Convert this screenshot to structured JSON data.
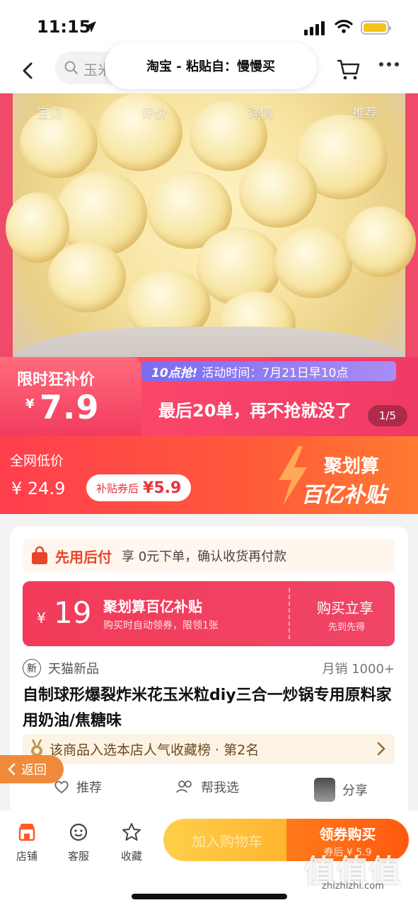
{
  "status": {
    "time": "11:15"
  },
  "nav": {
    "search_text": "玉米",
    "paste_banner": "淘宝 - 粘贴自：慢慢买"
  },
  "hero": {
    "tabs": [
      "宝贝",
      "评价",
      "详情",
      "推荐"
    ],
    "page_indicator": "1/5"
  },
  "promo": {
    "label": "限时狂补价",
    "yen": "¥",
    "price": "7.9",
    "flash_tag": "10点抢!",
    "activity_time": "活动时间：7月21日早10点",
    "main_text": "最后20单，再不抢就没了"
  },
  "price_banner": {
    "label": "全网低价",
    "original_price": "¥ 24.9",
    "coupon_label": "补贴券后",
    "coupon_price": "¥5.9",
    "logo_line1": "聚划算",
    "logo_line2": "百亿补贴"
  },
  "card": {
    "paylater_title": "先用后付",
    "paylater_text": "享 0元下单，确认收货再付款",
    "subsidy": {
      "yen": "¥",
      "amount": "19",
      "title": "聚划算百亿补贴",
      "subtitle": "购买时自动领券，限领1张",
      "buy_label": "购买立享",
      "first_label": "先到先得"
    },
    "new_badge": "新",
    "tmall_label": "天猫新品",
    "sales": "月销 1000+",
    "title": "自制球形爆裂炸米花玉米粒diy三合一炒锅专用原料家用奶油/焦糖味",
    "rank_text": "该商品入选本店人气收藏榜 · 第2名",
    "actions": {
      "recommend": "推荐",
      "help_choose": "帮我选",
      "share": "分享"
    }
  },
  "return_label": "返回",
  "bottom": {
    "shop": "店铺",
    "service": "客服",
    "favorite": "收藏",
    "add_cart": "加入购物车",
    "buy_now": "领券购买",
    "buy_now_sub": "券后 ¥ 5.9"
  },
  "watermark": {
    "brand": "值值值",
    "url": "zhizhizhi.com"
  },
  "colors": {
    "accent_red": "#f23b5a",
    "accent_orange": "#ff5a10",
    "gold": "#ffb42e"
  }
}
